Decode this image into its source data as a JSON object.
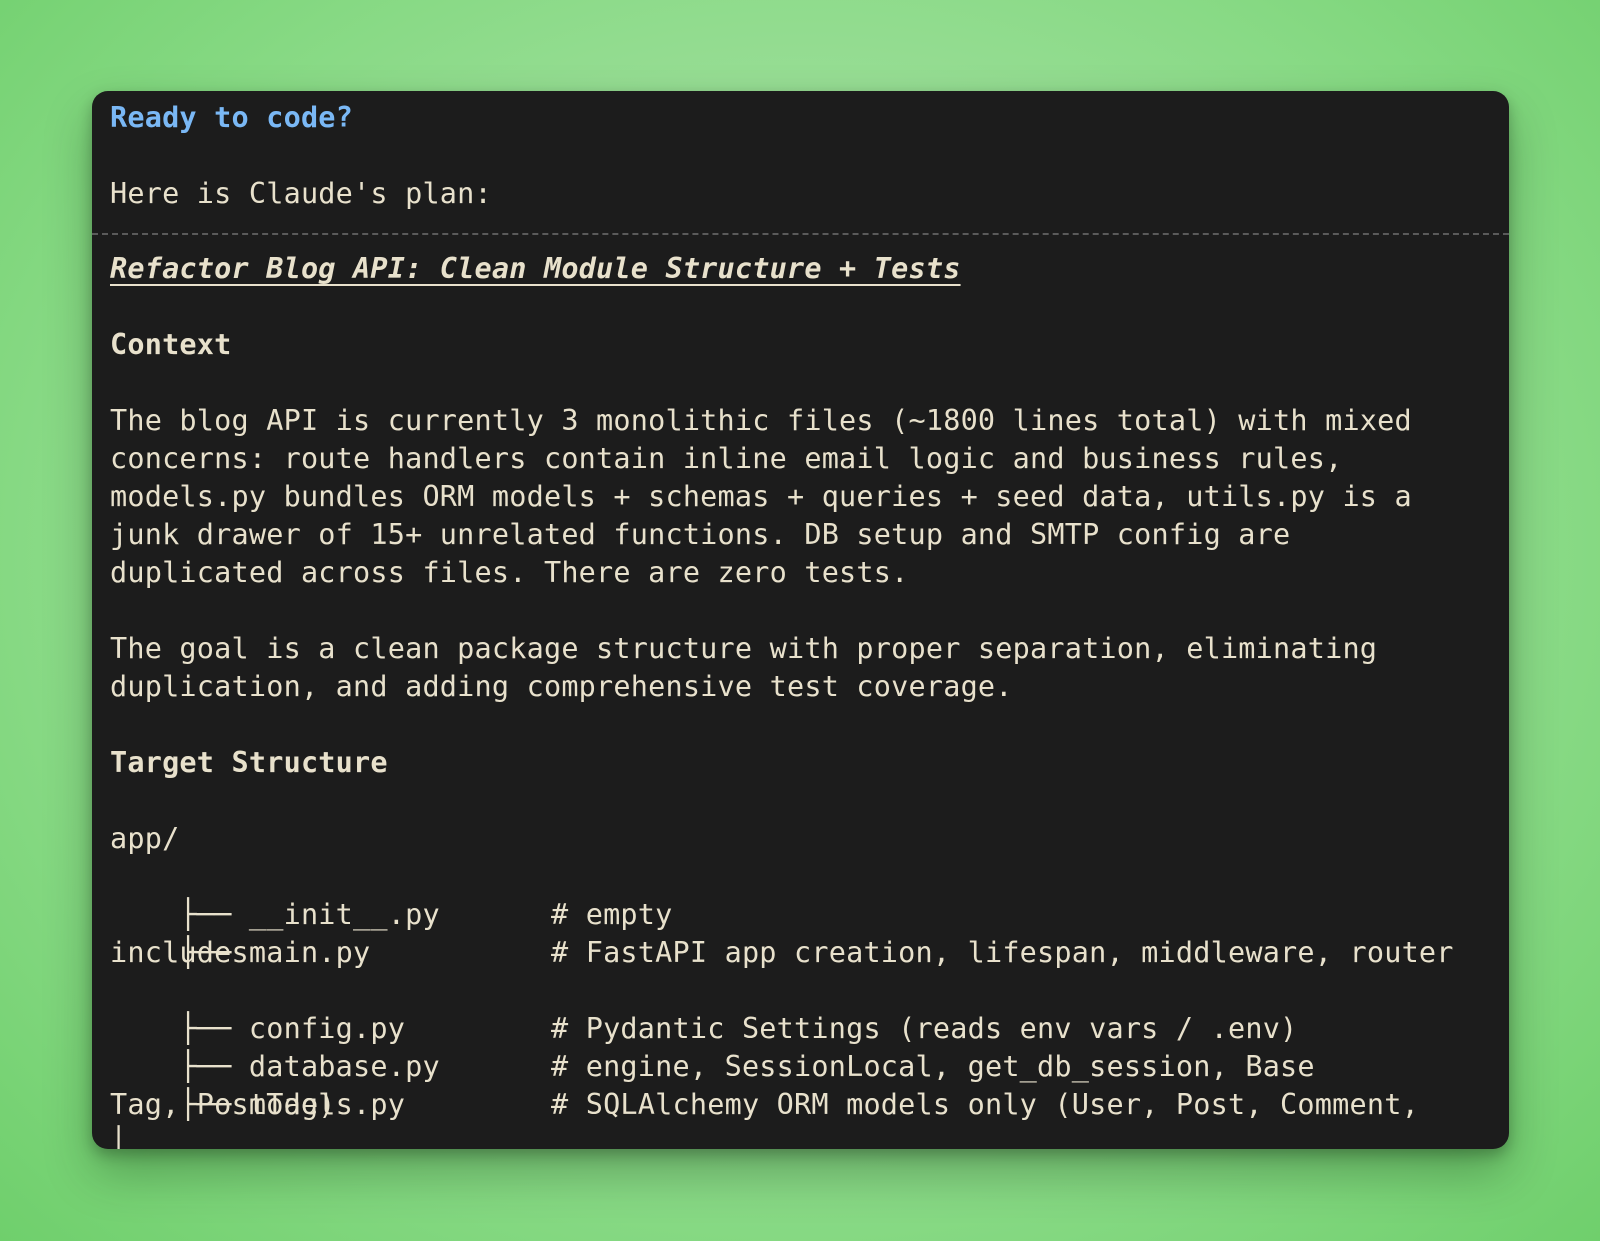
{
  "header": {
    "title": "Ready to code?",
    "intro": "Here is Claude's plan:"
  },
  "plan": {
    "title": "Refactor Blog API: Clean Module Structure + Tests",
    "context_heading": "Context",
    "context_lines": [
      "The blog API is currently 3 monolithic files (~1800 lines total) with mixed",
      "concerns: route handlers contain inline email logic and business rules,",
      "models.py bundles ORM models + schemas + queries + seed data, utils.py is a",
      "junk drawer of 15+ unrelated functions. DB setup and SMTP config are",
      "duplicated across files. There are zero tests."
    ],
    "goal_lines": [
      "The goal is a clean package structure with proper separation, eliminating",
      "duplication, and adding comprehensive test coverage."
    ],
    "structure_heading": "Target Structure",
    "tree_root": "app/",
    "tree": [
      {
        "prefix": "├── ",
        "file": "__init__.py",
        "comment": "# empty"
      },
      {
        "prefix": "├── ",
        "file": "main.py",
        "comment": "# FastAPI app creation, lifespan, middleware, router",
        "wrap": "includes"
      },
      {
        "prefix": "├── ",
        "file": "config.py",
        "comment": "# Pydantic Settings (reads env vars / .env)"
      },
      {
        "prefix": "├── ",
        "file": "database.py",
        "comment": "# engine, SessionLocal, get_db_session, Base"
      },
      {
        "prefix": "├── ",
        "file": "models.py",
        "comment": "# SQLAlchemy ORM models only (User, Post, Comment,",
        "wrap": "Tag, PostTag)"
      }
    ],
    "tree_cut_prefix": "│"
  },
  "colors": {
    "background": "#1c1c1c",
    "text": "#e8e1cc",
    "accent": "#7ab8f5",
    "page": "#8bd988"
  }
}
